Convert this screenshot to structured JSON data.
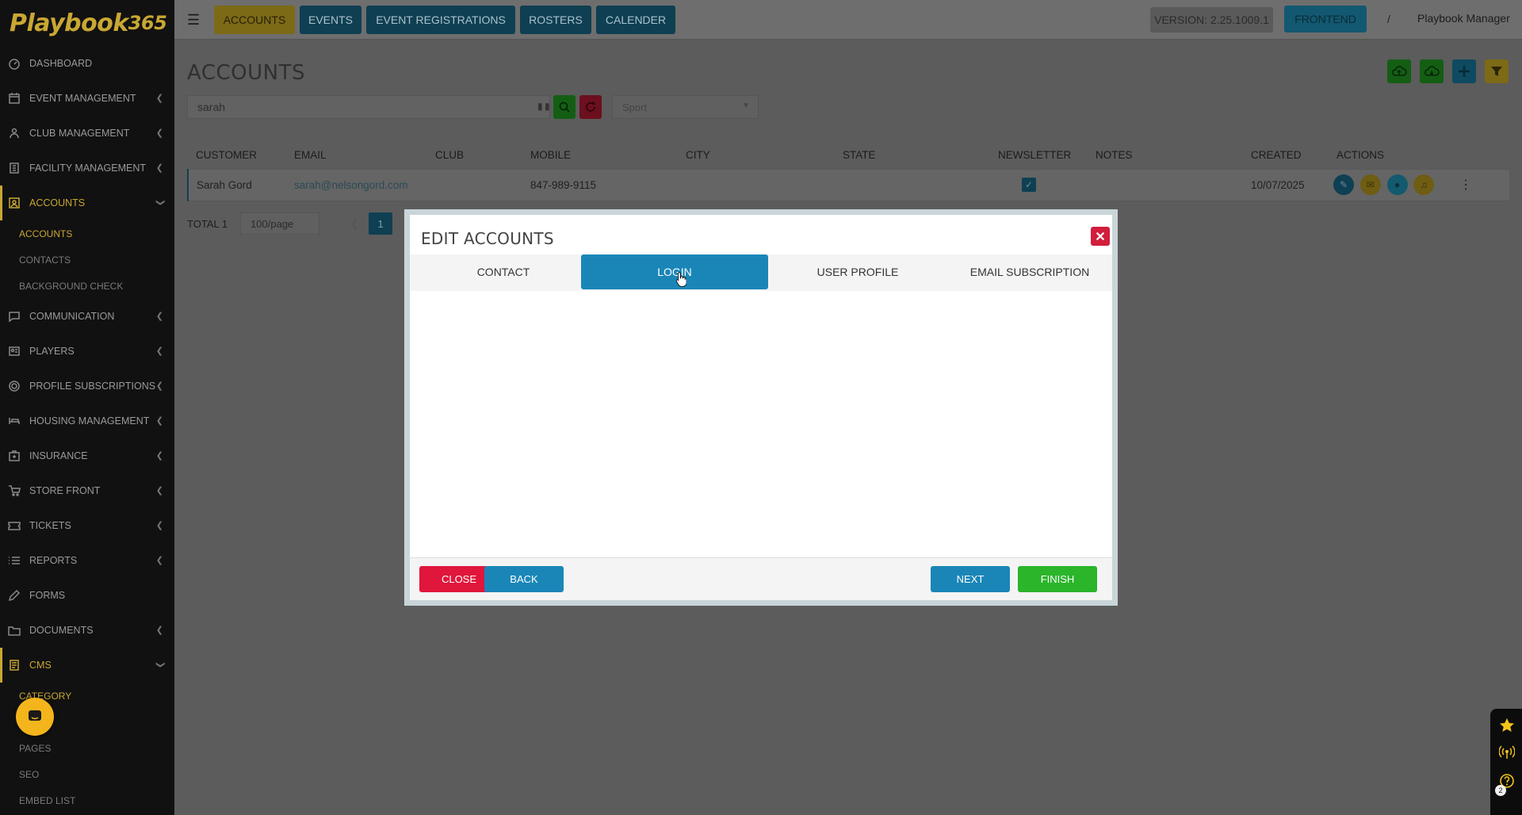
{
  "brand": {
    "logo_text": "Playbook",
    "logo_num": "365"
  },
  "sidebar": {
    "items": [
      {
        "label": "DASHBOARD"
      },
      {
        "label": "EVENT MANAGEMENT"
      },
      {
        "label": "CLUB MANAGEMENT"
      },
      {
        "label": "FACILITY MANAGEMENT"
      },
      {
        "label": "ACCOUNTS"
      },
      {
        "label": "COMMUNICATION"
      },
      {
        "label": "PLAYERS"
      },
      {
        "label": "PROFILE SUBSCRIPTIONS"
      },
      {
        "label": "HOUSING MANAGEMENT"
      },
      {
        "label": "INSURANCE"
      },
      {
        "label": "STORE FRONT"
      },
      {
        "label": "TICKETS"
      },
      {
        "label": "REPORTS"
      },
      {
        "label": "FORMS"
      },
      {
        "label": "DOCUMENTS"
      },
      {
        "label": "CMS"
      }
    ],
    "accounts_sub": [
      "ACCOUNTS",
      "CONTACTS",
      "BACKGROUND CHECK"
    ],
    "cms_sub": [
      "CATEGORY",
      "PAGES",
      "SEO",
      "EMBED LIST"
    ]
  },
  "topbar": {
    "tabs": [
      "ACCOUNTS",
      "EVENTS",
      "EVENT REGISTRATIONS",
      "ROSTERS",
      "CALENDER"
    ],
    "version": "VERSION: 2.25.1009.1",
    "frontend": "FRONTEND",
    "slash": "/",
    "user": "Playbook Manager"
  },
  "page": {
    "title": "ACCOUNTS",
    "search_value": "sarah",
    "sport_placeholder": "Sport"
  },
  "table": {
    "columns": [
      "CUSTOMER",
      "EMAIL",
      "CLUB",
      "MOBILE",
      "CITY",
      "STATE",
      "NEWSLETTER",
      "NOTES",
      "CREATED",
      "ACTIONS"
    ],
    "rows": [
      {
        "customer": "Sarah Gord",
        "email": "sarah@nelsongord.com",
        "club": "",
        "mobile": "847-989-9115",
        "city": "",
        "state": "",
        "newsletter": true,
        "notes": "",
        "created": "10/07/2025"
      }
    ]
  },
  "pager": {
    "total": "TOTAL 1",
    "page_size": "100/page",
    "current_page": "1"
  },
  "modal": {
    "title": "EDIT ACCOUNTS",
    "tabs": [
      "CONTACT",
      "LOGIN",
      "USER PROFILE",
      "EMAIL SUBSCRIPTION"
    ],
    "active_tab": "LOGIN",
    "buttons": {
      "close": "CLOSE",
      "back": "BACK",
      "next": "NEXT",
      "finish": "FINISH"
    }
  },
  "tray": {
    "badge": "2"
  },
  "colors": {
    "accent_gold": "#c9a733",
    "primary_blue": "#1a86b8",
    "danger_red": "#d21e3c",
    "success_green": "#2ab52a",
    "dark_teal": "#0f3f52"
  }
}
